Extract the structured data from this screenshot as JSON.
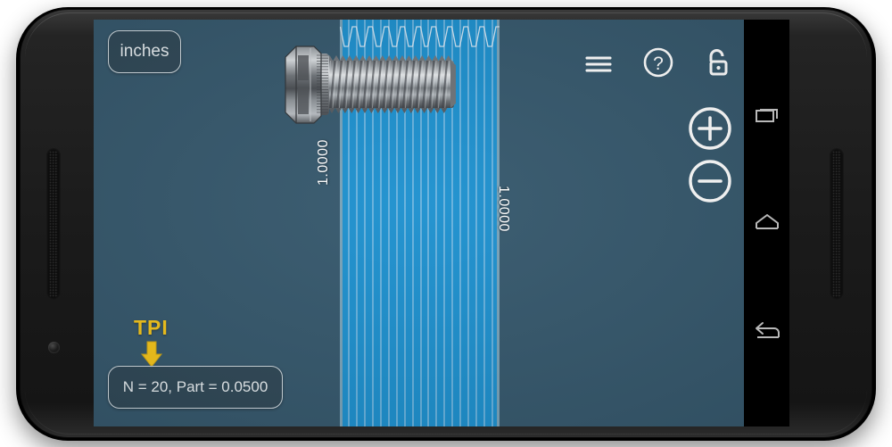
{
  "device": {
    "type": "android-phone-landscape",
    "bezel_color": "#1b1b1b"
  },
  "app": {
    "background_color": "#33566b",
    "units_button": {
      "label": "inches"
    },
    "result_button": {
      "label": "N = 20, Part = 0.0500"
    },
    "annotation": {
      "label": "TPI",
      "color": "#f5c518",
      "arrow": "down-arrow"
    },
    "toolbar": {
      "menu_icon": "hamburger-menu-icon",
      "help_icon": "question-mark-icon",
      "lock_icon": "unlocked-padlock-icon"
    },
    "zoom_controls": {
      "zoom_in_icon": "plus-circle-icon",
      "zoom_out_icon": "minus-circle-icon"
    },
    "measurement": {
      "band_color": "#1a8fce",
      "line_color": "#68b2dd",
      "left_dimension": "1.0000",
      "right_dimension": "1.0000",
      "thread_count": 20
    },
    "object": {
      "name": "hex-head-bolt-image",
      "description": "machine screw"
    }
  },
  "navbar": {
    "recents_label": "recents-icon",
    "home_label": "home-icon",
    "back_label": "back-icon"
  }
}
